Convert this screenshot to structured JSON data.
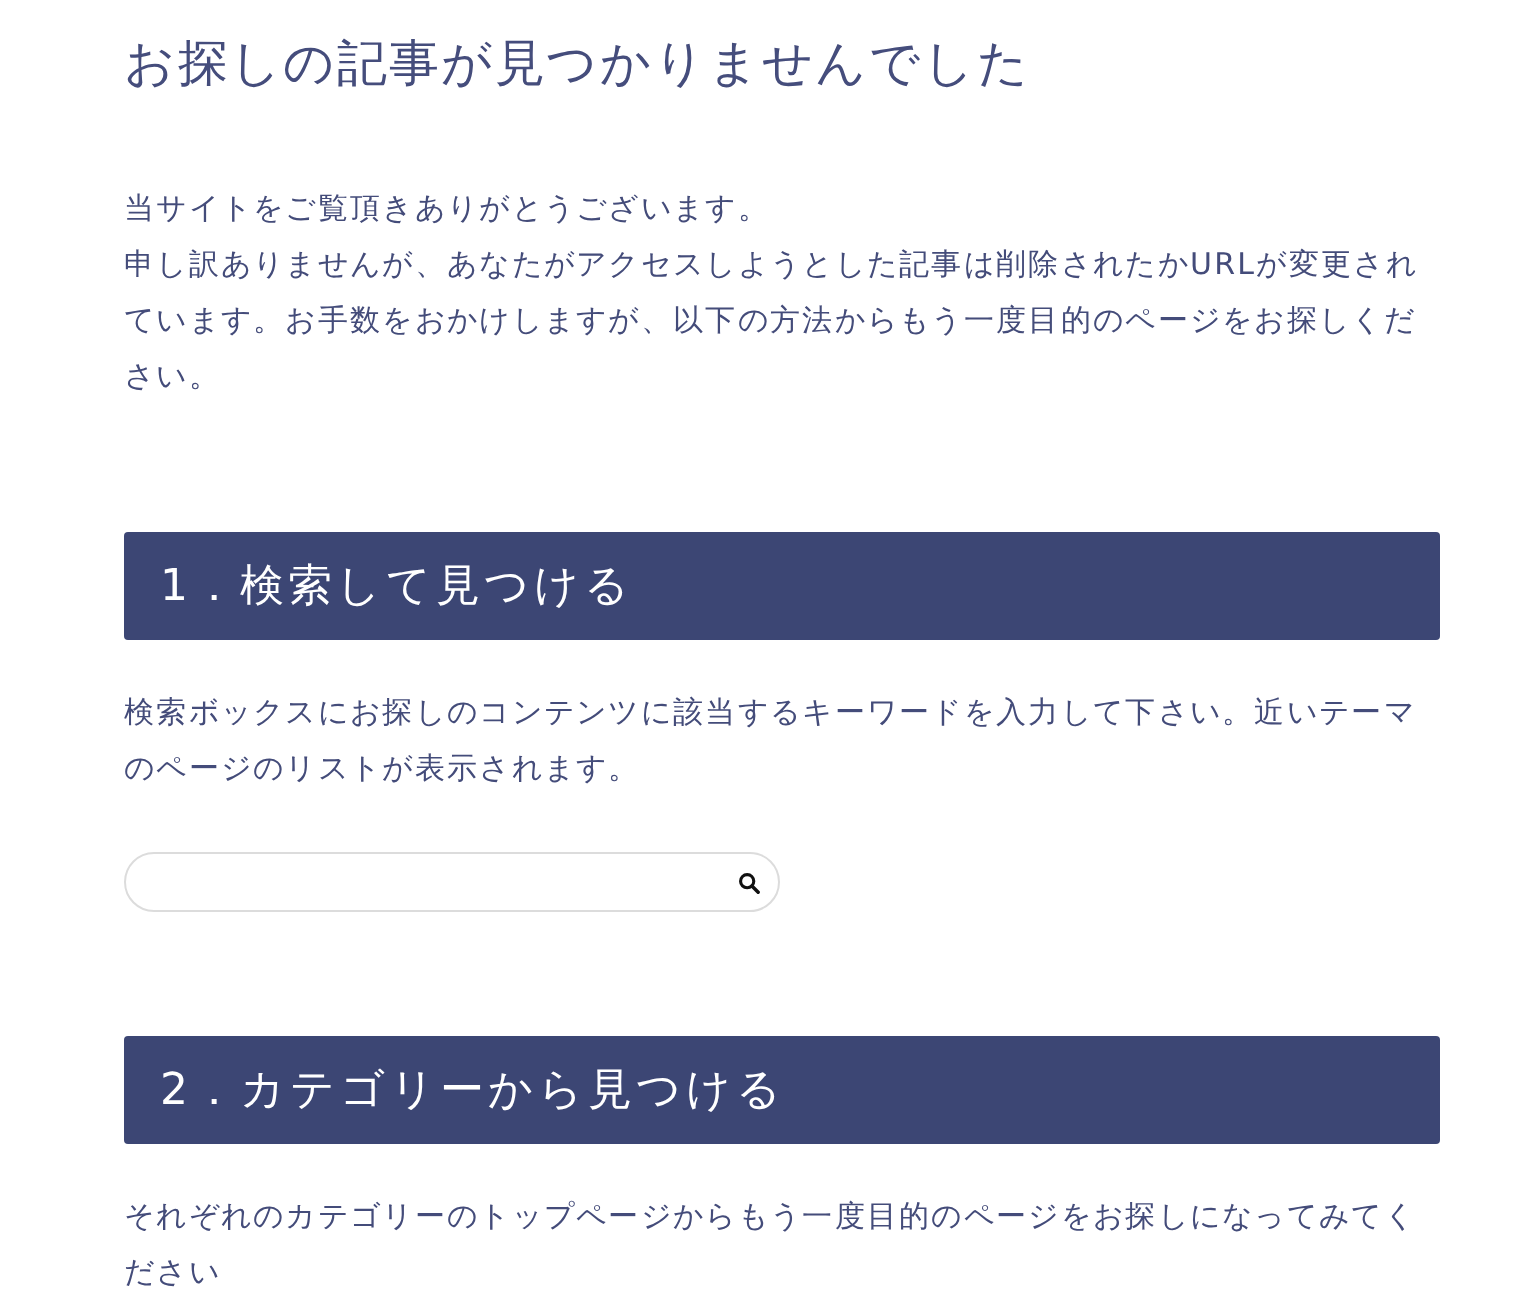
{
  "page_title": "お探しの記事が見つかりませんでした",
  "intro": [
    "当サイトをご覧頂きありがとうございます。",
    "申し訳ありませんが、あなたがアクセスしようとした記事は削除されたかURLが変更されています。お手数をおかけしますが、以下の方法からもう一度目的のページをお探しください。"
  ],
  "sections": [
    {
      "kind": "search",
      "heading": "1．検索して見つける",
      "description": "検索ボックスにお探しのコンテンツに該当するキーワードを入力して下さい。近いテーマのページのリストが表示されます。"
    },
    {
      "kind": "text",
      "heading": "2．カテゴリーから見つける",
      "description": "それぞれのカテゴリーのトップページからもう一度目的のページをお探しになってみてください"
    }
  ]
}
